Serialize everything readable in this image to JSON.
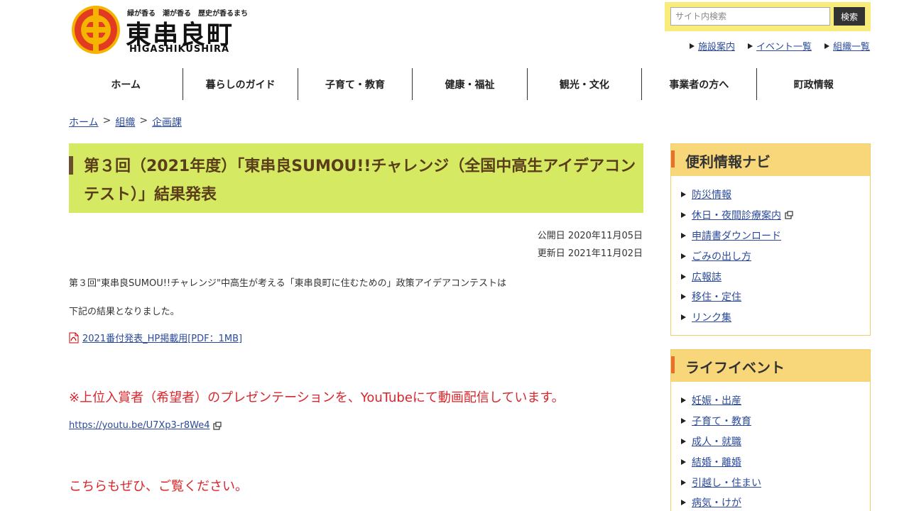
{
  "header": {
    "tagline": "緑が香る　潮が香る　歴史が香るまち",
    "town_name": "東串良町",
    "town_name_roman": "HIGASHIKUSHIRA",
    "search": {
      "placeholder": "サイト内検索",
      "button": "検索"
    },
    "util_links": [
      {
        "label": "施設案内"
      },
      {
        "label": "イベント一覧"
      },
      {
        "label": "組織一覧"
      }
    ]
  },
  "global_nav": [
    {
      "label": "ホーム"
    },
    {
      "label": "暮らしのガイド"
    },
    {
      "label": "子育て・教育"
    },
    {
      "label": "健康・福祉"
    },
    {
      "label": "観光・文化"
    },
    {
      "label": "事業者の方へ"
    },
    {
      "label": "町政情報"
    }
  ],
  "breadcrumb": {
    "items": [
      "ホーム",
      "組織",
      "企画課"
    ],
    "separator": ">"
  },
  "article": {
    "title": "第３回（2021年度）「東串良SUMOU!!チャレンジ（全国中高生アイデアコンテスト）」結果発表",
    "published": "公開日 2020年11月05日",
    "updated": "更新日 2021年11月02日",
    "intro_line1": "第３回\"東串良SUMOU!!チャレンジ\"中高生が考える「東串良町に住むための」政策アイデアコンテストは",
    "intro_line2": "下記の結果となりました。",
    "pdf_link": "2021番付発表_HP掲載用[PDF：1MB]",
    "notice": "※上位入賞者（希望者）のプレゼンテーションを、YouTubeにて動画配信しています。",
    "youtube_link": "https://youtu.be/U7Xp3-r8We4",
    "closing": "こちらもぜひ、ご覧ください。"
  },
  "sidebar": {
    "boxes": [
      {
        "heading": "便利情報ナビ",
        "items": [
          {
            "label": "防災情報",
            "external": false
          },
          {
            "label": "休日・夜間診療案内",
            "external": true
          },
          {
            "label": "申請書ダウンロード",
            "external": false
          },
          {
            "label": "ごみの出し方",
            "external": false
          },
          {
            "label": "広報誌",
            "external": false
          },
          {
            "label": "移住・定住",
            "external": false
          },
          {
            "label": "リンク集",
            "external": false
          }
        ]
      },
      {
        "heading": "ライフイベント",
        "items": [
          {
            "label": "妊娠・出産"
          },
          {
            "label": "子育て・教育"
          },
          {
            "label": "成人・就職"
          },
          {
            "label": "結婚・離婚"
          },
          {
            "label": "引越し・住まい"
          },
          {
            "label": "病気・けが"
          }
        ]
      }
    ]
  },
  "colors": {
    "title_bg": "#d5ea62",
    "title_text": "#5a3d1b",
    "notice_red": "#d9252b",
    "sidebar_head": "#f7d77a",
    "search_bg": "#f8ec7b",
    "link_blue": "#2b4a9b"
  }
}
